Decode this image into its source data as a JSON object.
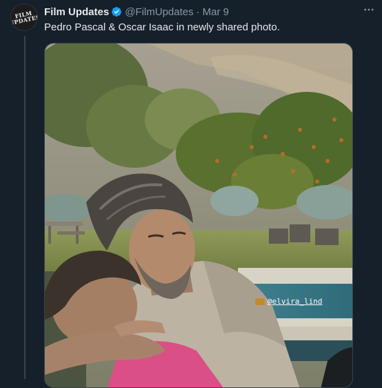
{
  "tweet": {
    "author_name": "Film Updates",
    "handle": "@FilmUpdates",
    "separator": "·",
    "date": "Mar 9",
    "text": "Pedro Pascal & Oscar Isaac in newly shared photo.",
    "more_icon": "more-horizontal-icon",
    "verified_icon": "verified-badge-icon"
  },
  "avatar": {
    "logo_line1": "FILM",
    "logo_line2": "UPDATES"
  },
  "media": {
    "instagram_tag": "@elvira_lind"
  },
  "colors": {
    "background": "#15202b",
    "verified": "#1d9bf0",
    "secondary_text": "#8b98a5"
  }
}
